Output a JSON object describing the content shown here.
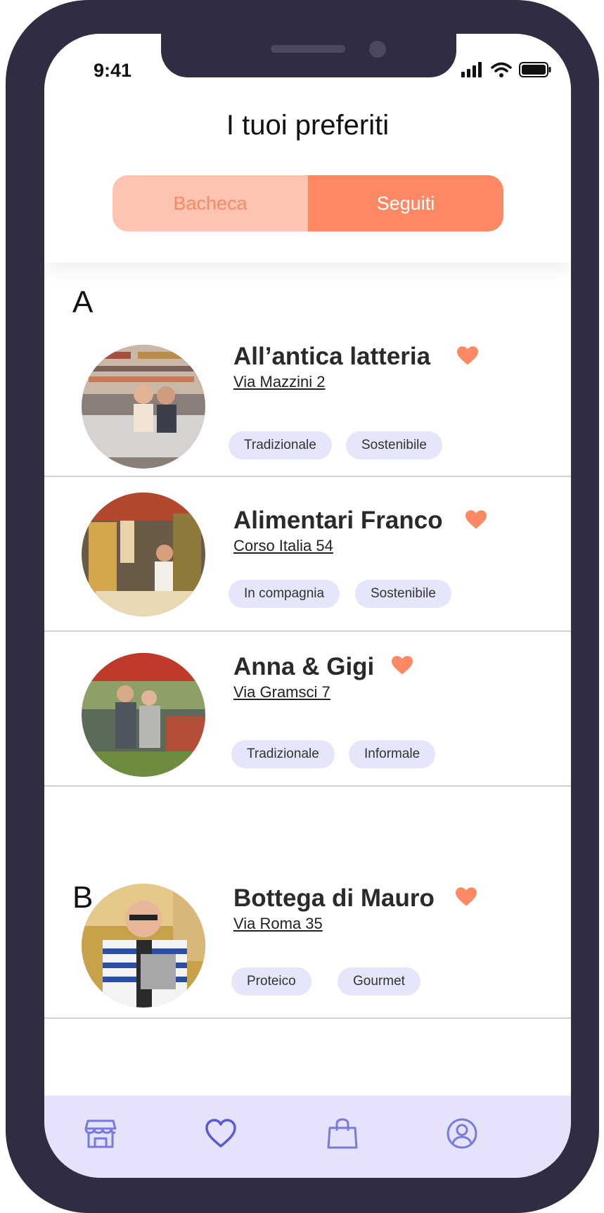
{
  "status_bar": {
    "time": "9:41"
  },
  "header": {
    "title": "I tuoi preferiti",
    "tabs": [
      {
        "label": "Bacheca",
        "active": false
      },
      {
        "label": "Seguiti",
        "active": true
      }
    ]
  },
  "sections": [
    {
      "letter": "A",
      "shops": [
        {
          "name": "All’antica latteria",
          "address": "Via Mazzini 2",
          "tags": [
            "Tradizionale",
            "Sostenibile"
          ]
        },
        {
          "name": "Alimentari Franco",
          "address": "Corso Italia 54",
          "tags": [
            "In compagnia",
            "Sostenibile"
          ]
        },
        {
          "name": "Anna & Gigi",
          "address": "Via Gramsci 7",
          "tags": [
            "Tradizionale",
            "Informale"
          ]
        }
      ]
    },
    {
      "letter": "B",
      "shops": [
        {
          "name": "Bottega di Mauro",
          "address": "Via Roma 35",
          "tags": [
            "Proteico",
            "Gourmet"
          ]
        }
      ]
    }
  ],
  "tabbar": {
    "items": [
      {
        "icon": "shop-icon",
        "active": false
      },
      {
        "icon": "heart-icon",
        "active": true
      },
      {
        "icon": "shopping-bag-icon",
        "active": false
      },
      {
        "icon": "user-icon",
        "active": false
      }
    ]
  },
  "colors": {
    "accent": "#fd8964",
    "accent_light": "#fdc4b1",
    "tag_bg": "#e6e6fb",
    "tabbar_bg": "#e4e3fb",
    "tab_icon": "#7a79e0",
    "frame": "#2e2d42"
  }
}
